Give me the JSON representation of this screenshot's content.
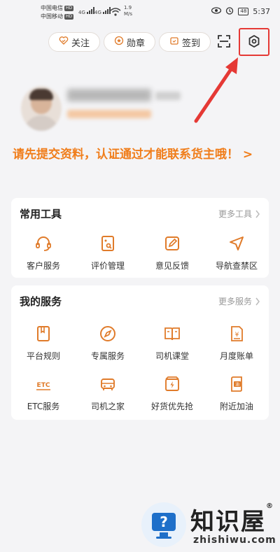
{
  "status_bar": {
    "carrier_1": "中国电信",
    "carrier_2": "中国移动",
    "hd": "HD",
    "signal_1": "4G",
    "signal_2": "4G",
    "speed_value": "1.9",
    "speed_unit": "M/s",
    "battery": "48",
    "time": "5:37"
  },
  "top_actions": {
    "follow_label": "关注",
    "medal_label": "勋章",
    "checkin_label": "签到"
  },
  "profile": {
    "phone_masked": "177****7920"
  },
  "notice": {
    "text": "请先提交资料，认证通过才能联系货主哦！ >"
  },
  "tools": {
    "title": "常用工具",
    "more": "更多工具",
    "items": [
      {
        "label": "客户服务",
        "icon": "headset-icon"
      },
      {
        "label": "评价管理",
        "icon": "review-icon"
      },
      {
        "label": "意见反馈",
        "icon": "edit-icon"
      },
      {
        "label": "导航查禁区",
        "icon": "navigation-icon"
      }
    ]
  },
  "services": {
    "title": "我的服务",
    "more": "更多服务",
    "items": [
      {
        "label": "平台规则",
        "icon": "rules-book-icon"
      },
      {
        "label": "专属服务",
        "icon": "compass-icon"
      },
      {
        "label": "司机课堂",
        "icon": "open-book-icon"
      },
      {
        "label": "月度账单",
        "icon": "bill-icon"
      },
      {
        "label": "ETC服务",
        "icon": "etc-icon"
      },
      {
        "label": "司机之家",
        "icon": "car-icon"
      },
      {
        "label": "好货优先抢",
        "icon": "package-icon"
      },
      {
        "label": "附近加油",
        "icon": "fuel-icon"
      }
    ]
  },
  "watermark": {
    "title": "知识屋",
    "reg": "®",
    "url": "zhishiwu.com"
  },
  "colors": {
    "accent": "#f07d1a",
    "icon": "#e07b2a",
    "highlight": "#e53935",
    "background": "#f4f4f6"
  }
}
